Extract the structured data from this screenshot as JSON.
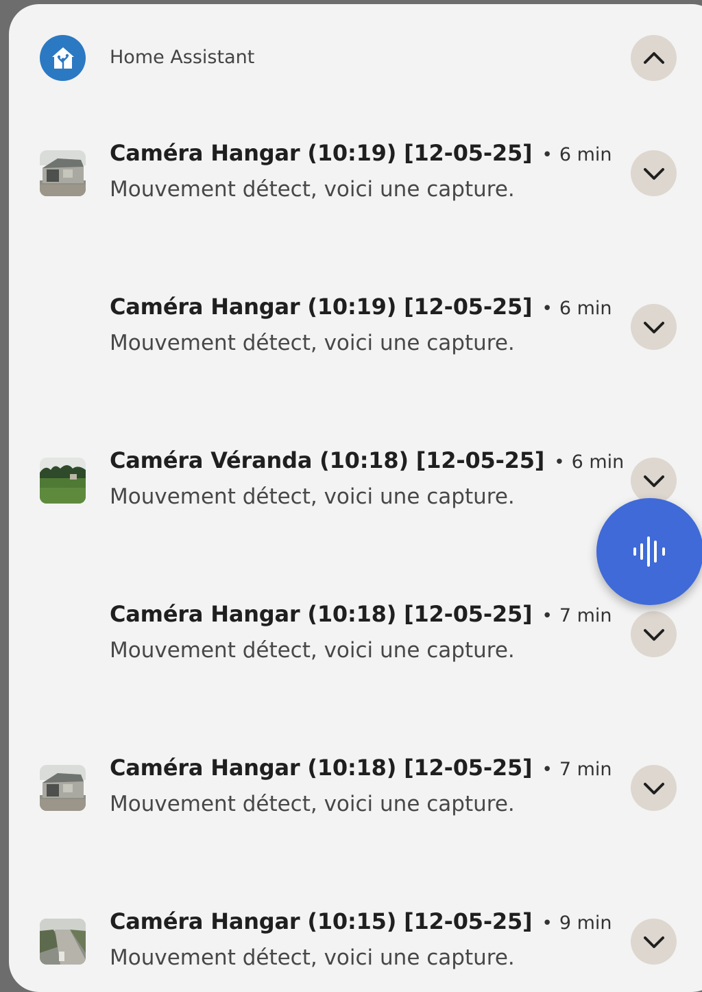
{
  "header": {
    "app_name": "Home Assistant",
    "app_icon": "home-assistant-icon",
    "collapse_icon": "chevron-up-icon"
  },
  "notifications": [
    {
      "title": "Caméra Hangar (10:19) [12-05-25]",
      "separator": "•",
      "time": "6 min",
      "body": "Mouvement détect, voici une capture.",
      "thumbnail": "barn",
      "expand_icon": "chevron-down-icon"
    },
    {
      "title": "Caméra Hangar (10:19) [12-05-25]",
      "separator": "•",
      "time": "6 min",
      "body": "Mouvement détect, voici une capture.",
      "thumbnail": "",
      "expand_icon": "chevron-down-icon"
    },
    {
      "title": "Caméra Véranda (10:18) [12-05-25]",
      "separator": "•",
      "time": "6 min",
      "body": "Mouvement détect, voici une capture.",
      "thumbnail": "garden",
      "expand_icon": "chevron-down-icon"
    },
    {
      "title": "Caméra Hangar (10:18) [12-05-25]",
      "separator": "•",
      "time": "7 min",
      "body": "Mouvement détect, voici une capture.",
      "thumbnail": "",
      "expand_icon": "chevron-down-icon"
    },
    {
      "title": "Caméra Hangar (10:18) [12-05-25]",
      "separator": "•",
      "time": "7 min",
      "body": "Mouvement détect, voici une capture.",
      "thumbnail": "barn",
      "expand_icon": "chevron-down-icon"
    },
    {
      "title": "Caméra Hangar (10:15) [12-05-25]",
      "separator": "•",
      "time": "9 min",
      "body": "Mouvement détect, voici une capture.",
      "thumbnail": "path",
      "expand_icon": "chevron-down-icon"
    }
  ],
  "fab": {
    "icon": "voice-assist-waveform-icon"
  },
  "colors": {
    "panel_bg": "#f3f3f3",
    "app_icon_bg": "#2b79c2",
    "button_bg": "#ded7cf",
    "fab_bg": "#3f6ad8",
    "outer_bg": "#6d6d6d"
  }
}
